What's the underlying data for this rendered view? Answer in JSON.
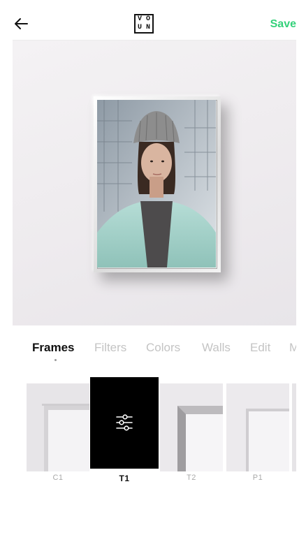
{
  "header": {
    "logo_letters": [
      "V",
      "O",
      "U",
      "N"
    ],
    "save_label": "Save"
  },
  "tabs": [
    {
      "label": "Frames",
      "active": true
    },
    {
      "label": "Filters",
      "active": false
    },
    {
      "label": "Colors",
      "active": false
    },
    {
      "label": "Walls",
      "active": false
    },
    {
      "label": "Edit",
      "active": false
    },
    {
      "label": "M",
      "active": false
    }
  ],
  "thumbnails": [
    {
      "label": "C1",
      "selected": false
    },
    {
      "label": "T1",
      "selected": true
    },
    {
      "label": "T2",
      "selected": false
    },
    {
      "label": "P1",
      "selected": false
    }
  ],
  "colors": {
    "accent": "#34d17a",
    "active_text": "#111111",
    "inactive_text": "#c4c4c4"
  }
}
